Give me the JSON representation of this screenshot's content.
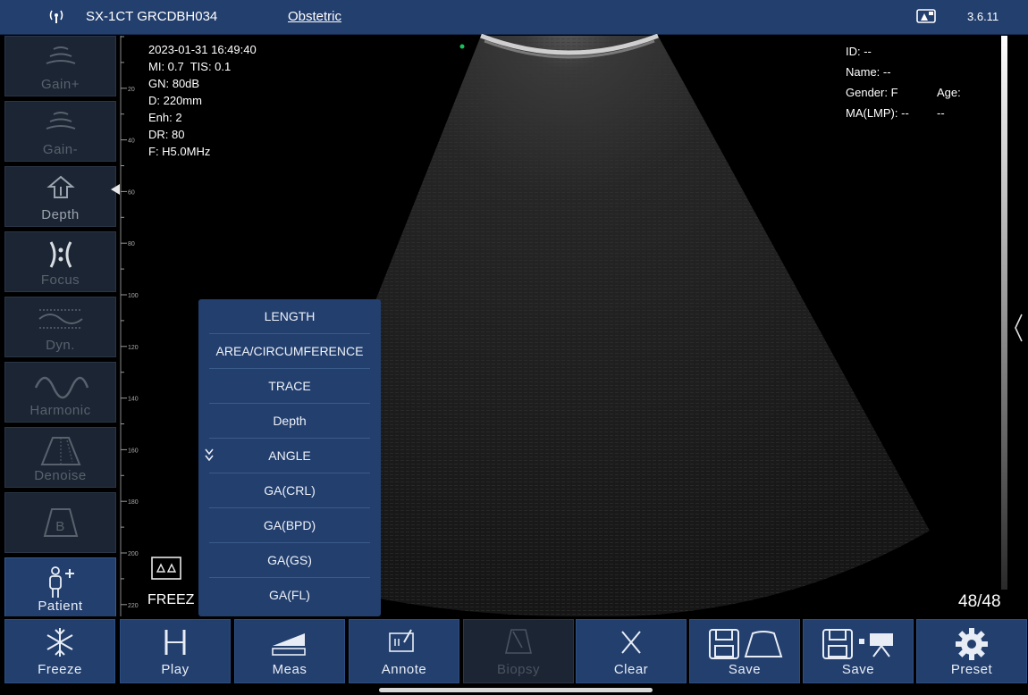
{
  "header": {
    "device": "SX-1CT GRCDBH034",
    "mode": "Obstetric",
    "version": "3.6.11",
    "icons": [
      "signal-icon",
      "probe-status-icon"
    ]
  },
  "sidebar": {
    "gain_plus": "Gain+",
    "gain_minus": "Gain-",
    "depth": "Depth",
    "focus": "Focus",
    "dyn": "Dyn.",
    "harmonic": "Harmonic",
    "denoise": "Denoise",
    "bmode": "B",
    "patient": "Patient"
  },
  "scale": {
    "ticks": [
      "20",
      "40",
      "60",
      "80",
      "100",
      "120",
      "140",
      "160",
      "180",
      "200",
      "220"
    ]
  },
  "scan_info": {
    "datetime": "2023-01-31 16:49:40",
    "mi_tis": "MI: 0.7  TIS: 0.1",
    "gain": "GN: 80dB",
    "depth": "D: 220mm",
    "enhance": "Enh: 2",
    "dynamic_range": "DR: 80",
    "frequency": "F: H5.0MHz"
  },
  "patient_info": {
    "id": "ID: --",
    "name": "Name: --",
    "gender": "Gender: F",
    "age": "Age: --",
    "lmp": "MA(LMP): --"
  },
  "measure_menu": {
    "items": [
      "LENGTH",
      "AREA/CIRCUMFERENCE",
      "TRACE",
      "Depth",
      "ANGLE",
      "GA(CRL)",
      "GA(BPD)",
      "GA(GS)",
      "GA(FL)"
    ]
  },
  "status": {
    "freeze_text": "FREEZ",
    "frame_counter": "48/48"
  },
  "toolbar": {
    "freeze": "Freeze",
    "play": "Play",
    "meas": "Meas",
    "annote": "Annote",
    "biopsy": "Biopsy",
    "clear": "Clear",
    "save_image": "Save",
    "save_cine": "Save",
    "preset": "Preset"
  },
  "colors": {
    "accent": "#233f6e",
    "panel_dark": "#1c2533",
    "background": "#000000"
  }
}
